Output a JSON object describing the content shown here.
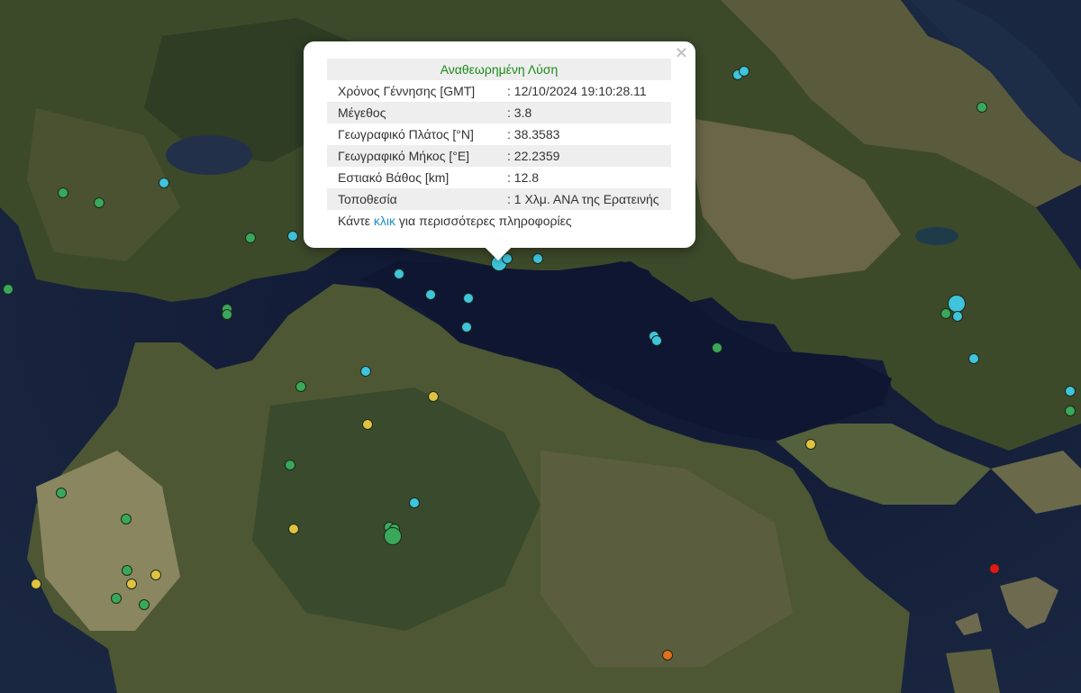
{
  "popup": {
    "heading": "Αναθεωρημένη Λύση",
    "close_symbol": "×",
    "rows": [
      {
        "label": "Χρόνος Γέννησης [GMT]",
        "value": ": 12/10/2024 19:10:28.11"
      },
      {
        "label": "Μέγεθος",
        "value": ": 3.8"
      },
      {
        "label": "Γεωγραφικό Πλάτος [°N]",
        "value": ": 38.3583"
      },
      {
        "label": "Γεωγραφικό Μήκος [°E]",
        "value": ": 22.2359"
      },
      {
        "label": "Εστιακό Βάθος [km]",
        "value": ": 12.8"
      },
      {
        "label": "Τοποθεσία",
        "value": ": 1 Χλμ. ΑΝΑ της Ερατεινής"
      }
    ],
    "more_before": "Κάντε ",
    "more_link": "κλικ",
    "more_after": " για περισσότερες πληροφορίες"
  },
  "colors": {
    "cyan": "#3fc4dc",
    "green": "#3aa85a",
    "yellow": "#e0c240",
    "orange": "#e0701c",
    "red": "#e01818"
  }
}
